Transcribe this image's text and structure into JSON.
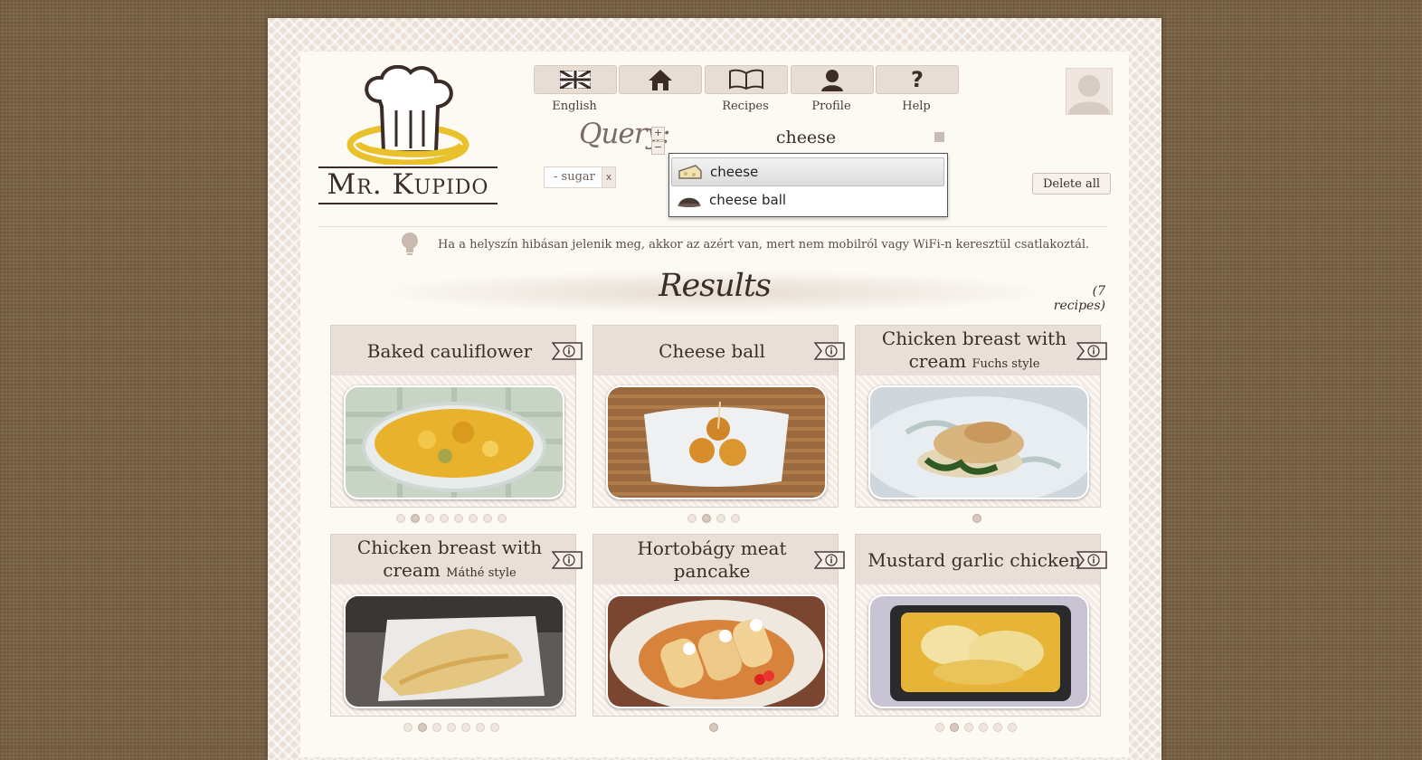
{
  "app": {
    "logo_text": "Mr. Kupido"
  },
  "nav": [
    {
      "label": "English",
      "icon": "uk-flag-icon"
    },
    {
      "label": "",
      "icon": "home-icon"
    },
    {
      "label": "Recipes",
      "icon": "book-icon"
    },
    {
      "label": "Profile",
      "icon": "user-icon"
    },
    {
      "label": "Help",
      "icon": "question-icon"
    }
  ],
  "query": {
    "label": "Query:",
    "value": "cheese",
    "stepper_plus": "+",
    "stepper_minus": "−",
    "suggestions": [
      {
        "label": "cheese",
        "icon": "cheese-icon",
        "selected": true
      },
      {
        "label": "cheese ball",
        "icon": "cheese-ball-icon",
        "selected": false
      }
    ],
    "tags": [
      {
        "label": "- sugar",
        "remove": "x"
      }
    ],
    "delete_all": "Delete all"
  },
  "tip": {
    "icon": "lightbulb-icon",
    "text": "Ha a helyszín hibásan jelenik meg, akkor az azért van, mert nem mobilról vagy WiFi-n keresztül csatlakoztál."
  },
  "results": {
    "title": "Results",
    "count": "(7 recipes)",
    "cards": [
      {
        "title": "Baked cauliflower",
        "sub": "",
        "dots": 8,
        "active": 1
      },
      {
        "title": "Cheese ball",
        "sub": "",
        "dots": 4,
        "active": 1
      },
      {
        "title": "Chicken breast with cream",
        "sub": "Fuchs style",
        "dots": 1,
        "active": 0
      },
      {
        "title": "Chicken breast with cream",
        "sub": "Máthé style",
        "dots": 7,
        "active": 1
      },
      {
        "title": "Hortobágy meat pancake",
        "sub": "",
        "dots": 1,
        "active": 0
      },
      {
        "title": "Mustard garlic chicken",
        "sub": "",
        "dots": 6,
        "active": 1
      }
    ]
  },
  "colors": {
    "page_bg": "#fdfaf4",
    "card_head": "#e9dfd8",
    "text": "#3a2e28",
    "background": "#7a6244"
  }
}
